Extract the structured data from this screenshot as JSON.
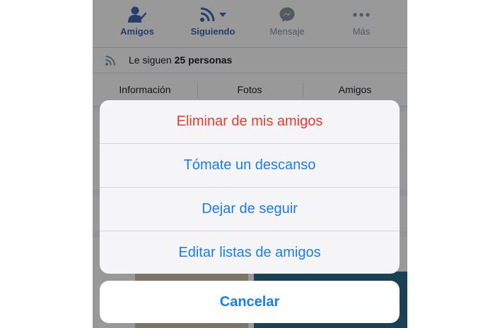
{
  "actions": {
    "friends": "Amigos",
    "following": "Siguiendo",
    "message": "Mensaje",
    "more": "Más"
  },
  "followers": {
    "prefix": "Le siguen",
    "count": "25 personas"
  },
  "tabs": [
    "Información",
    "Fotos",
    "Amigos"
  ],
  "sheet": {
    "options": [
      "Eliminar de mis amigos",
      "Tómate un descanso",
      "Dejar de seguir",
      "Editar listas de amigos"
    ],
    "cancel": "Cancelar"
  },
  "colors": {
    "facebook_blue": "#4267b2",
    "ios_blue": "#1a7cf2",
    "destructive_red": "#ec3a34"
  },
  "icons": {
    "friends": "friend-check-icon",
    "following": "rss-icon",
    "message": "messenger-icon",
    "more": "more-dots-icon",
    "followers": "rss-icon"
  }
}
